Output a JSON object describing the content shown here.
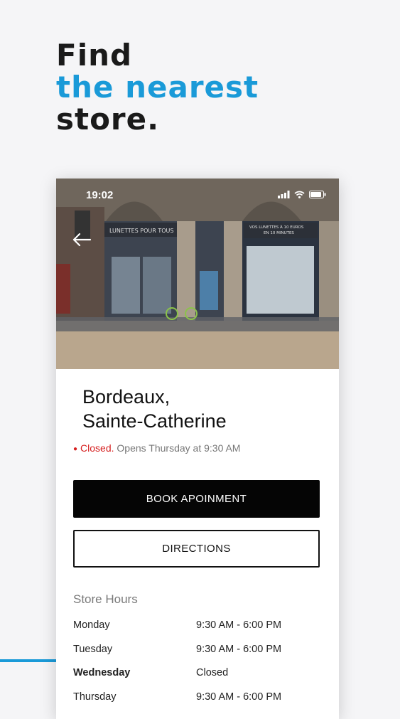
{
  "headline": {
    "line1": "Find",
    "line2": "the nearest",
    "line3": "store."
  },
  "colors": {
    "accent": "#1a9ad8",
    "closed": "#d62020",
    "primary_button": "#050505"
  },
  "status_bar": {
    "time": "19:02"
  },
  "hero": {
    "sign_left": "LUNETTES POUR TOUS",
    "sign_right_line1": "VOS LUNETTES À 10 EUROS",
    "sign_right_line2": "EN 10 MINUTES"
  },
  "store": {
    "name_line1": "Bordeaux,",
    "name_line2": "Sainte-Catherine",
    "status_closed": "Closed.",
    "status_next": "Opens Thursday at 9:30 AM"
  },
  "actions": {
    "book_label": "BOOK APOINMENT",
    "directions_label": "DIRECTIONS"
  },
  "hours": {
    "title": "Store Hours",
    "rows": [
      {
        "day": "Monday",
        "time": "9:30 AM - 6:00 PM"
      },
      {
        "day": "Tuesday",
        "time": "9:30 AM - 6:00 PM"
      },
      {
        "day": "Wednesday",
        "time": "Closed"
      },
      {
        "day": "Thursday",
        "time": "9:30 AM - 6:00 PM"
      }
    ]
  }
}
